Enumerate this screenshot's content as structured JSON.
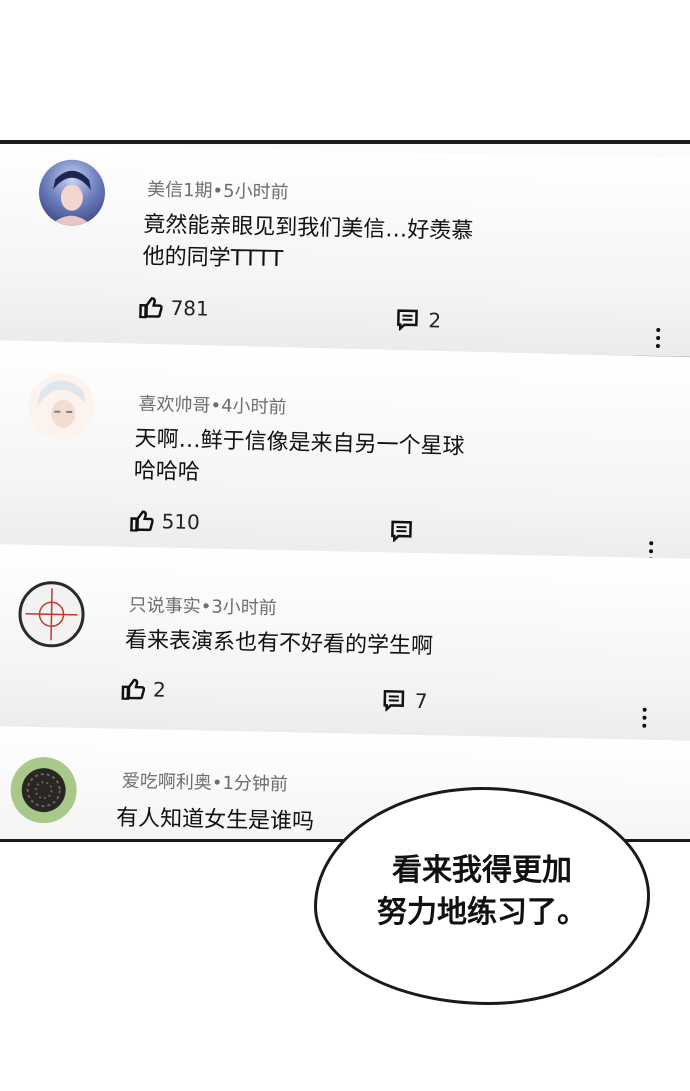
{
  "comments": [
    {
      "user": "美信1期",
      "time": "5小时前",
      "line1": "竟然能亲眼见到我们美信…好羡慕",
      "line2": "他的同学TTTT",
      "likes": "781",
      "replies": "2"
    },
    {
      "user": "喜欢帅哥",
      "time": "4小时前",
      "line1": "天啊…鲜于信像是来自另一个星球",
      "line2": "哈哈哈",
      "likes": "510",
      "replies": ""
    },
    {
      "user": "只说事实",
      "time": "3小时前",
      "line1": "看来表演系也有不好看的学生啊",
      "line2": "",
      "likes": "2",
      "replies": "7"
    },
    {
      "user": "爱吃啊利奥",
      "time": "1分钟前",
      "line1": "有人知道女生是谁吗",
      "line2": "",
      "likes": "",
      "replies": ""
    }
  ],
  "separator": "•",
  "speech_bubble": {
    "line1": "看来我得更加",
    "line2": "努力地练习了。"
  },
  "colors": {
    "text": "#111111",
    "meta": "#6e6e6e",
    "border": "#1b1b1b"
  }
}
